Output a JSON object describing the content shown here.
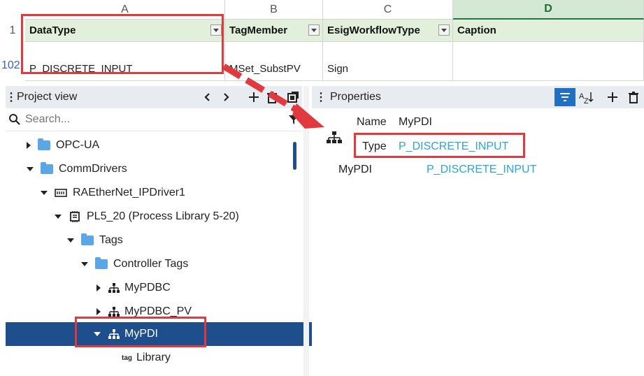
{
  "spreadsheet": {
    "columns": [
      "A",
      "B",
      "C",
      "D"
    ],
    "header_row_number": "1",
    "data_row_number": "102",
    "headers": [
      "DataType",
      "TagMember",
      "EsigWorkflowType",
      "Caption"
    ],
    "row": [
      "P_DISCRETE_INPUT",
      "MSet_SubstPV",
      "Sign",
      ""
    ]
  },
  "project_view": {
    "title": "Project view",
    "search_placeholder": "Search...",
    "tree": [
      {
        "label": "OPC-UA"
      },
      {
        "label": "CommDrivers"
      },
      {
        "label": "RAEtherNet_IPDriver1"
      },
      {
        "label": "PL5_20 (Process Library 5-20)"
      },
      {
        "label": "Tags"
      },
      {
        "label": "Controller Tags"
      },
      {
        "label": "MyPDBC"
      },
      {
        "label": "MyPDBC_PV"
      },
      {
        "label": "MyPDI"
      },
      {
        "label": "Library",
        "prefix": "tag"
      }
    ]
  },
  "properties": {
    "title": "Properties",
    "name_label": "Name",
    "name_value": "MyPDI",
    "type_label": "Type",
    "type_value": "P_DISCRETE_INPUT",
    "row_name": "MyPDI",
    "row_value": "P_DISCRETE_INPUT"
  },
  "colors": {
    "highlight": "#e0393e",
    "selection": "#1f4e8c",
    "link": "#2aa4e0"
  }
}
